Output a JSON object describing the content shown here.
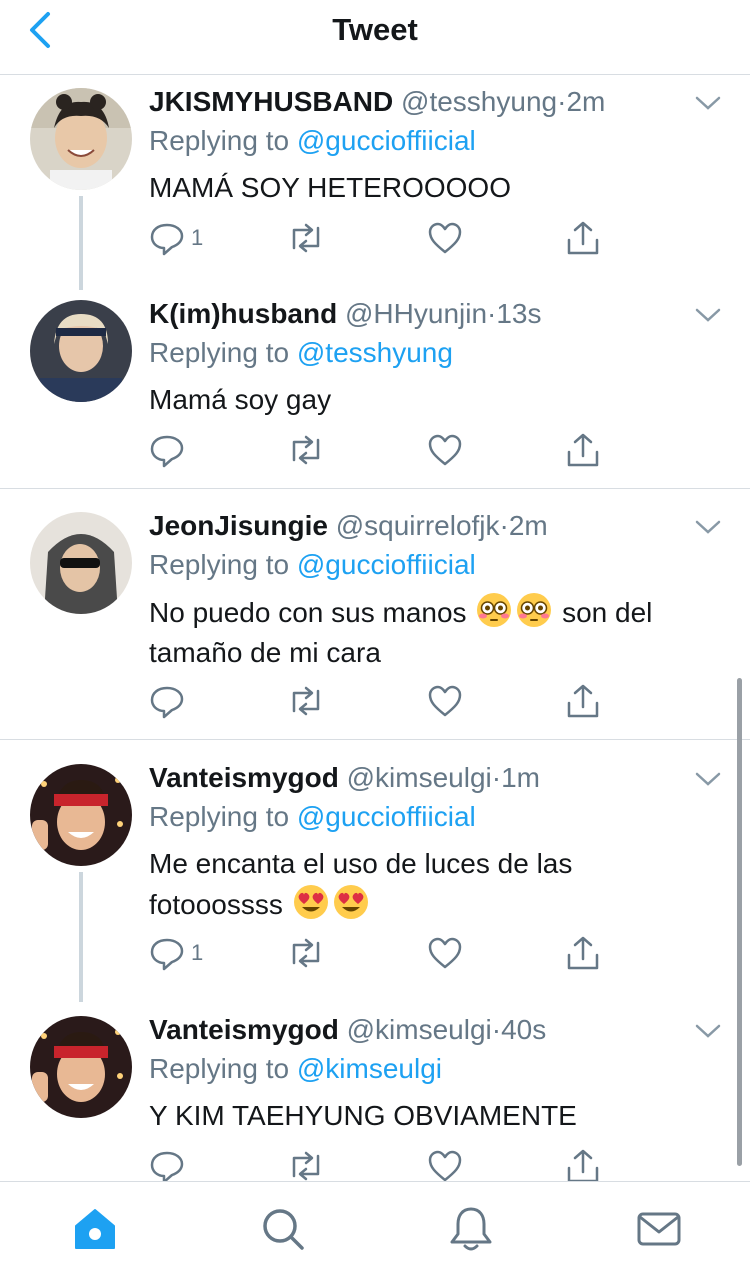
{
  "header": {
    "title": "Tweet"
  },
  "colors": {
    "accent": "#1da1f2",
    "secondary_text": "#657786",
    "divider": "#d8dde2"
  },
  "tweets": [
    {
      "name": "JKISMYHUSBAND",
      "handle": "@tesshyung",
      "time": "2m",
      "replying_label": "Replying to",
      "replying_to": "@guccioffiicial",
      "text": "MAMÁ SOY HETEROOOOO",
      "reply_count": "1"
    },
    {
      "name": "K(im)husband",
      "handle": "@HHyunjin",
      "time": "13s",
      "replying_label": "Replying to",
      "replying_to": "@tesshyung",
      "text": "Mamá soy gay",
      "reply_count": ""
    },
    {
      "name": "JeonJisungie",
      "handle": "@squirrelofjk",
      "time": "2m",
      "replying_label": "Replying to",
      "replying_to": "@guccioffiicial",
      "text_part1": "No puedo con sus manos",
      "text_part2": "son del",
      "text_line2": "tamaño de mi cara",
      "reply_count": ""
    },
    {
      "name": "Vanteismygod",
      "handle": "@kimseulgi",
      "time": "1m",
      "replying_label": "Replying to",
      "replying_to": "@guccioffiicial",
      "text_line1": "Me encanta el uso de luces de las",
      "text_line2": "fotooossss",
      "reply_count": "1"
    },
    {
      "name": "Vanteismygod",
      "handle": "@kimseulgi",
      "time": "40s",
      "replying_label": "Replying to",
      "replying_to": "@kimseulgi",
      "text": "Y KIM TAEHYUNG OBVIAMENTE",
      "reply_count": ""
    }
  ],
  "tabbar": {
    "items": [
      "home-icon",
      "search-icon",
      "notifications-icon",
      "messages-icon"
    ]
  }
}
